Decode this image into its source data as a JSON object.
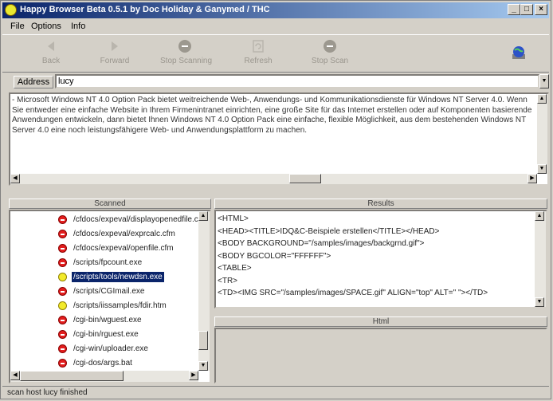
{
  "window": {
    "title": "Happy Browser Beta 0.5.1 by Doc Holiday & Ganymed / THC",
    "controls": [
      "_",
      "□",
      "×"
    ]
  },
  "menu": [
    "File",
    "Options",
    "Info"
  ],
  "toolbar": {
    "back": "Back",
    "forward": "Forward",
    "stop": "Stop Scanning",
    "refresh": "Refresh",
    "stop_scan": "Stop Scan"
  },
  "address": {
    "label": "Address",
    "value": "lucy"
  },
  "description": "- Microsoft Windows NT 4.0 Option Pack bietet weitreichende Web-, Anwendungs- und Kommunikationsdienste für Windows NT Server 4.0. Wenn Sie entweder eine einfache Website in Ihrem Firmenintranet einrichten, eine große Site für das Internet erstellen oder auf Komponenten basierende Anwendungen entwickeln, dann bietet Ihnen Windows NT 4.0 Option Pack eine einfache, flexible Möglichkeit, aus dem bestehenden Windows NT Server 4.0 eine noch leistungsfähigere Web- und Anwendungsplattform zu machen.",
  "panels": {
    "scanned_title": "Scanned",
    "results_title": "Results",
    "html_title": "Html"
  },
  "scanned": [
    {
      "path": "/cfdocs/expeval/displayopenedfile.cfm",
      "status": "bad"
    },
    {
      "path": "/cfdocs/expeval/exprcalc.cfm",
      "status": "bad"
    },
    {
      "path": "/cfdocs/expeval/openfile.cfm",
      "status": "bad"
    },
    {
      "path": "/scripts/fpcount.exe",
      "status": "bad"
    },
    {
      "path": "/scripts/tools/newdsn.exe",
      "status": "ok",
      "selected": true
    },
    {
      "path": "/scripts/CGImail.exe",
      "status": "bad"
    },
    {
      "path": "/scripts/iissamples/fdir.htm",
      "status": "ok"
    },
    {
      "path": "/cgi-bin/wguest.exe",
      "status": "bad"
    },
    {
      "path": "/cgi-bin/rguest.exe",
      "status": "bad"
    },
    {
      "path": "/cgi-win/uploader.exe",
      "status": "bad"
    },
    {
      "path": "/cgi-dos/args.bat",
      "status": "bad"
    }
  ],
  "results": [
    "<HTML>",
    "<HEAD><TITLE>IDQ&C-Beispiele erstellen</TITLE></HEAD>",
    "<BODY BACKGROUND=\"/samples/images/backgrnd.gif\">",
    "<BODY BGCOLOR=\"FFFFFF\">",
    "<TABLE>",
    "<TR>",
    "<TD><IMG SRC=\"/samples/images/SPACE.gif\" ALIGN=\"top\" ALT=\" \"></TD>"
  ],
  "status": "scan host lucy finished"
}
